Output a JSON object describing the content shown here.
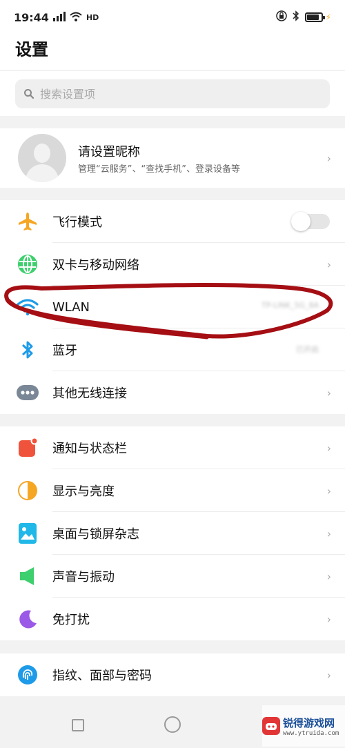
{
  "status_bar": {
    "time": "19:44",
    "network": "HD",
    "battery_level": 0.85
  },
  "header": {
    "title": "设置"
  },
  "search": {
    "placeholder": "搜索设置项"
  },
  "profile": {
    "name": "请设置昵称",
    "subtitle": "管理“云服务”、“查找手机”、登录设备等"
  },
  "section1": {
    "items": [
      {
        "label": "飞行模式",
        "icon": "airplane-icon",
        "color": "#f5a623",
        "toggle": false
      },
      {
        "label": "双卡与移动网络",
        "icon": "globe-icon",
        "color": "#3ecf6e"
      },
      {
        "label": "WLAN",
        "icon": "wifi-icon",
        "color": "#1e9be8",
        "value": "TP-LINK_5G_8A"
      },
      {
        "label": "蓝牙",
        "icon": "bluetooth-icon",
        "color": "#1e9be8",
        "value": "已开启"
      },
      {
        "label": "其他无线连接",
        "icon": "more-dots-icon",
        "color": "#7a8797"
      }
    ]
  },
  "section2": {
    "items": [
      {
        "label": "通知与状态栏",
        "icon": "notification-icon",
        "color": "#f0533c"
      },
      {
        "label": "显示与亮度",
        "icon": "brightness-icon",
        "color": "#f5a623"
      },
      {
        "label": "桌面与锁屏杂志",
        "icon": "wallpaper-icon",
        "color": "#20b8e8"
      },
      {
        "label": "声音与振动",
        "icon": "speaker-icon",
        "color": "#3ecf6e"
      },
      {
        "label": "免打扰",
        "icon": "moon-icon",
        "color": "#9b59e8"
      }
    ]
  },
  "section3": {
    "items": [
      {
        "label": "指纹、面部与密码",
        "icon": "fingerprint-icon",
        "color": "#1e9be8"
      }
    ]
  },
  "chevron": "›",
  "watermark": {
    "title": "锐得游戏网",
    "url": "www.ytruida.com"
  },
  "colors": {
    "annotation": "#a50f14",
    "accent": "#1e9be8"
  }
}
